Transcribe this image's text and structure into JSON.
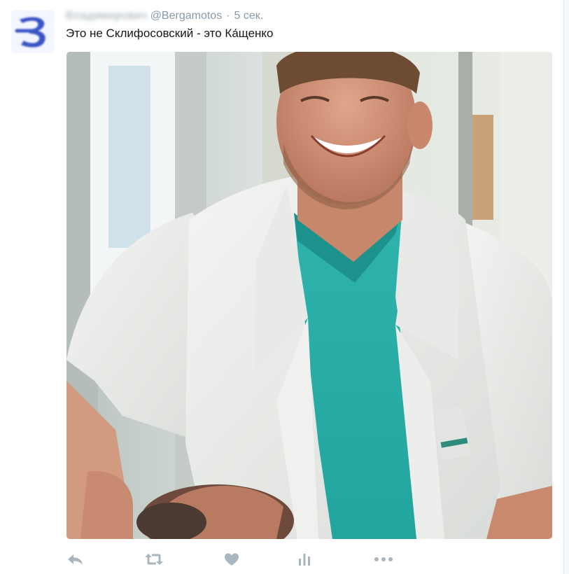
{
  "tweet": {
    "display_name": "Владимирович",
    "username": "@Bergamotos",
    "separator": "·",
    "timestamp": "5 сек.",
    "text": "Это не Склифосовский - это Ка́щенко",
    "avatar_icon": "letter-b-logo-icon",
    "media": {
      "kind": "photo",
      "subject": "smiling man in white doctor coat over teal scrubs holding a patient's head"
    }
  },
  "actions": [
    {
      "name": "reply",
      "icon": "reply-icon"
    },
    {
      "name": "retweet",
      "icon": "retweet-icon"
    },
    {
      "name": "like",
      "icon": "heart-icon"
    },
    {
      "name": "analytics",
      "icon": "bar-chart-icon"
    },
    {
      "name": "more",
      "icon": "more-dots-icon"
    }
  ],
  "colors": {
    "action_gray": "#a9b6c0",
    "meta_gray": "#8899a6",
    "text": "#14171a",
    "avatar_blue": "#3b54c4"
  }
}
